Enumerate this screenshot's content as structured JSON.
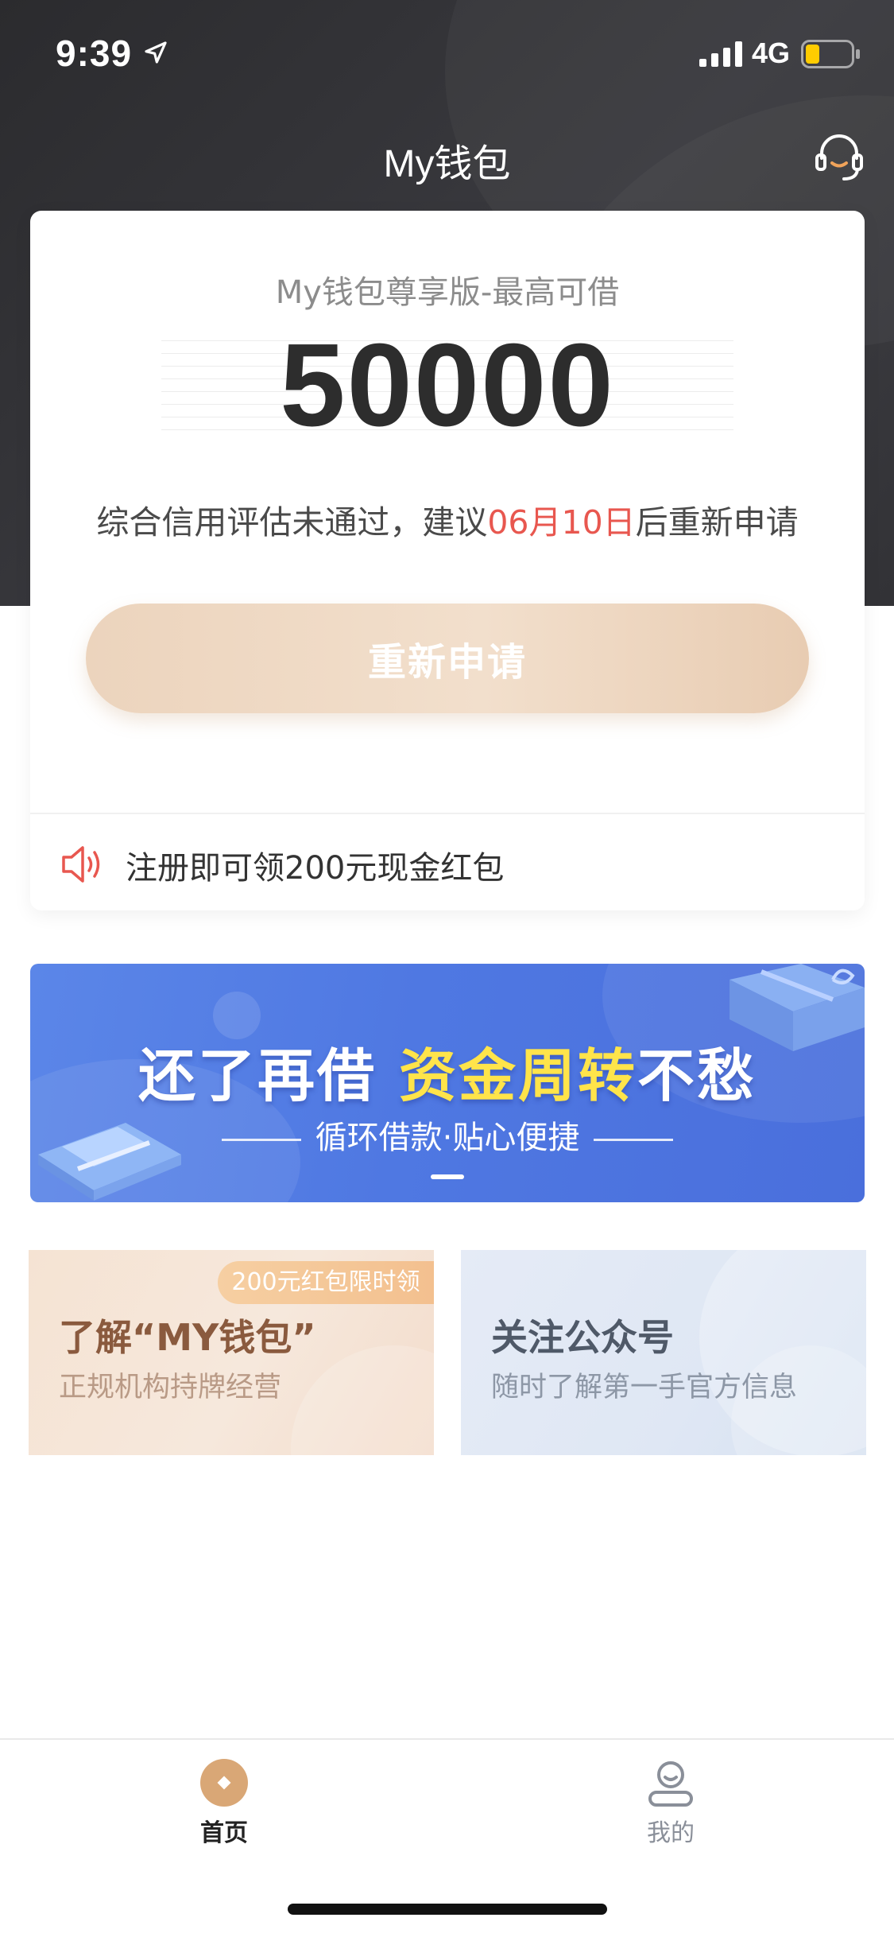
{
  "status_bar": {
    "time": "9:39",
    "network": "4G"
  },
  "nav": {
    "title": "My钱包"
  },
  "credit_card": {
    "subtitle": "My钱包尊享版-最高可借",
    "amount": "50000",
    "notice_prefix": "综合信用评估未通过，建议",
    "notice_date": "06月10日",
    "notice_suffix": "后重新申请",
    "button_label": "重新申请",
    "promo_text": "注册即可领200元现金红包"
  },
  "banner": {
    "headline_part1": "还了再借",
    "headline_highlight": "资金周转",
    "headline_part2": "不愁",
    "subtitle": "循环借款·贴心便捷"
  },
  "cards": [
    {
      "tag": "200元红包限时领",
      "title": "了解“MY钱包”",
      "description": "正规机构持牌经营"
    },
    {
      "title": "关注公众号",
      "description": "随时了解第一手官方信息"
    }
  ],
  "tab_bar": {
    "home_label": "首页",
    "mine_label": "我的"
  },
  "colors": {
    "accent_red": "#e8574f",
    "button_beige": "#ecd4bd",
    "banner_blue": "#4f78e2",
    "highlight_yellow": "#ffe44a",
    "tab_gold": "#d9a776"
  },
  "icons": {
    "support": "headset-icon",
    "promo": "speaker-icon",
    "home_tab": "home-coin-icon",
    "mine_tab": "user-icon"
  }
}
